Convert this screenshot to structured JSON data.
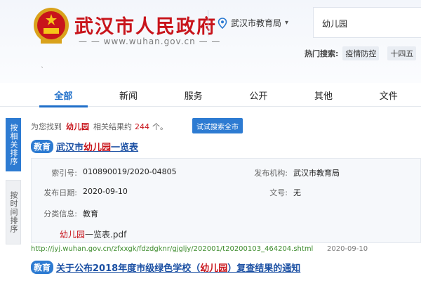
{
  "header": {
    "site_title": "武汉市人民政府",
    "site_url": "www.wuhan.gov.cn",
    "location": "武汉市教育局",
    "search_value": "幼儿园",
    "hot_label": "热门搜索:",
    "hot_items": [
      "疫情防控",
      "十四五"
    ],
    "emblem": "national-emblem-icon"
  },
  "tabs": [
    "全部",
    "新闻",
    "服务",
    "公开",
    "其他",
    "文件"
  ],
  "sort": {
    "relevance": "按相关排序",
    "time": "按时间排序"
  },
  "summary": {
    "prefix": "为您找到",
    "keyword": "幼儿园",
    "middle": "相关结果约",
    "count": "244",
    "suffix": "个。",
    "search_all": "试试搜索全市"
  },
  "results": [
    {
      "badge": "教育",
      "title_pre": "武汉市",
      "title_hl": "幼儿园",
      "title_post": "一览表",
      "meta": {
        "index_label": "索引号:",
        "index_value": "010890019/2020-04805",
        "org_label": "发布机构:",
        "org_value": "武汉市教育局",
        "date_label": "发布日期:",
        "date_value": "2020-09-10",
        "doc_label": "文号:",
        "doc_value": "无",
        "cat_label": "分类信息:",
        "cat_value": "教育"
      },
      "attachment_hl": "幼儿园",
      "attachment_post": "一览表.pdf",
      "url": "http://jyj.wuhan.gov.cn/zfxxgk/fdzdgknr/gjgljy/202001/t20200103_464204.shtml",
      "date": "2020-09-10"
    },
    {
      "badge": "教育",
      "title_pre": "关于公布2018年度市级绿色学校（",
      "title_hl": "幼儿园",
      "title_post": "）复查结果的通知"
    }
  ],
  "colors": {
    "brand_red": "#c8141b",
    "accent_blue": "#2d7bd2",
    "link_blue": "#1a4fa3",
    "url_green": "#3a8a2a"
  }
}
